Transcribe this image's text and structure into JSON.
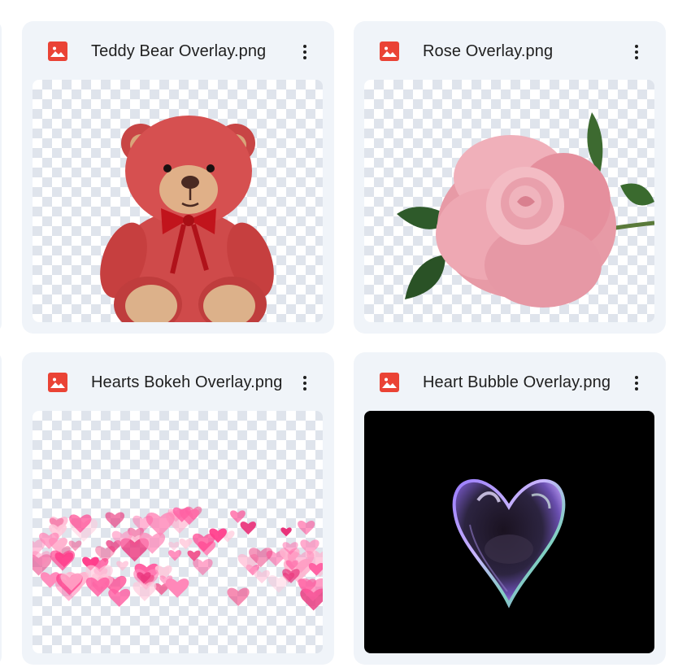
{
  "files": [
    {
      "name": "Teddy Bear Overlay.png",
      "icon": "image-file-icon",
      "thumbnail": "teddy-bear",
      "menu_icon": "more-vert-icon"
    },
    {
      "name": "Rose Overlay.png",
      "icon": "image-file-icon",
      "thumbnail": "pink-rose",
      "menu_icon": "more-vert-icon"
    },
    {
      "name": "Hearts Bokeh Overlay.png",
      "icon": "image-file-icon",
      "thumbnail": "hearts-bokeh",
      "menu_icon": "more-vert-icon"
    },
    {
      "name": "Heart Bubble Overlay.png",
      "icon": "image-file-icon",
      "thumbnail": "heart-bubble",
      "menu_icon": "more-vert-icon"
    }
  ],
  "colors": {
    "card_background": "#f0f4f9",
    "file_icon_red": "#ea4335",
    "text_primary": "#1f1f1f",
    "checker_gray": "#dfe4ec"
  }
}
